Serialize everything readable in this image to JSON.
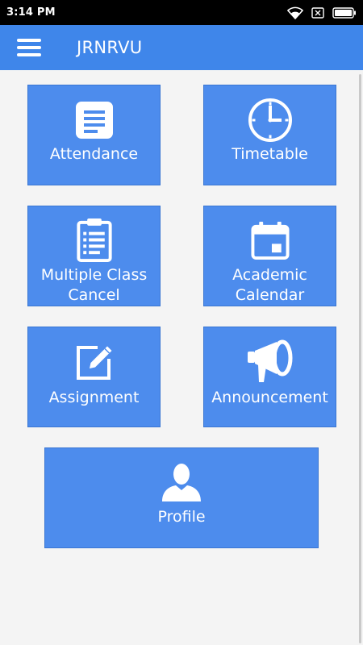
{
  "status_bar": {
    "time": "3:14 PM",
    "icons": [
      "wifi-icon",
      "sim-off-icon",
      "battery-icon"
    ]
  },
  "app_bar": {
    "title": "JRNRVU",
    "menu_icon": "hamburger-menu-icon"
  },
  "colors": {
    "app_bar": "#3f86ea",
    "tile": "#4d8ced",
    "background": "#f4f4f4"
  },
  "tiles": [
    {
      "label": "Attendance",
      "icon": "document-icon"
    },
    {
      "label": "Timetable",
      "icon": "clock-icon"
    },
    {
      "label": "Multiple Class\nCancel",
      "icon": "clipboard-icon"
    },
    {
      "label": "Academic\nCalendar",
      "icon": "calendar-icon"
    },
    {
      "label": "Assignment",
      "icon": "edit-icon"
    },
    {
      "label": "Announcement",
      "icon": "megaphone-icon"
    },
    {
      "label": "Profile",
      "icon": "user-icon"
    }
  ]
}
